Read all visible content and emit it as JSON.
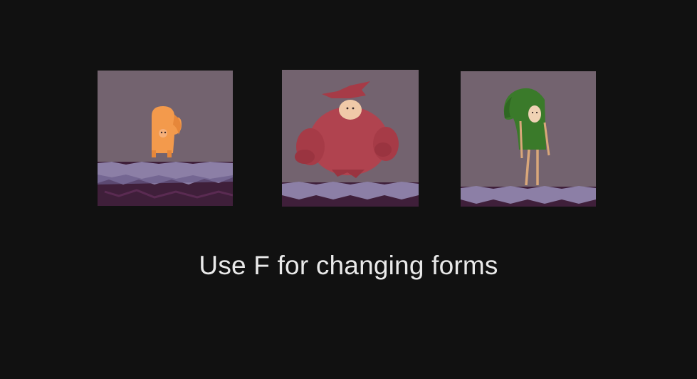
{
  "forms": [
    {
      "icon": "fox-form-icon",
      "body_color": "#f39a4c"
    },
    {
      "icon": "golem-form-icon",
      "body_color": "#b0434f"
    },
    {
      "icon": "tall-hood-form-icon",
      "body_color": "#3a7a2a"
    }
  ],
  "hint": {
    "text": "Use F for changing forms"
  },
  "colors": {
    "background": "#111111",
    "sky": "#73636f",
    "ground_top": "#8c7fa6",
    "ground_soil": "#3f1f3a",
    "text": "#e9e9e9"
  }
}
